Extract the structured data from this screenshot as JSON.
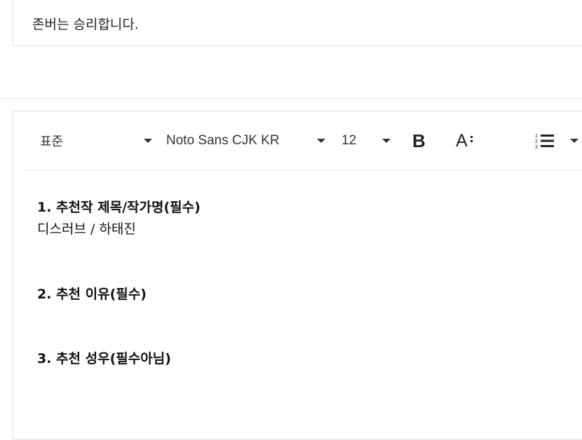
{
  "title_field": {
    "value": "존버는 승리합니다."
  },
  "toolbar": {
    "paragraph_style": "표준",
    "font_family": "Noto Sans CJK KR",
    "font_size": "12",
    "bold_label": "B",
    "font_size_icon_label": "A",
    "icons": {
      "bold": "bold-icon",
      "text_size": "text-size-icon",
      "numbered_list": "numbered-list-icon",
      "dropdown": "chevron-down-icon"
    }
  },
  "content": {
    "q1_heading": "1. 추천작 제목/작가명(필수)",
    "q1_answer": "디스러브 / 하태진",
    "q2_heading": "2. 추천 이유(필수)",
    "q3_heading": "3. 추천 성우(필수아님)"
  }
}
